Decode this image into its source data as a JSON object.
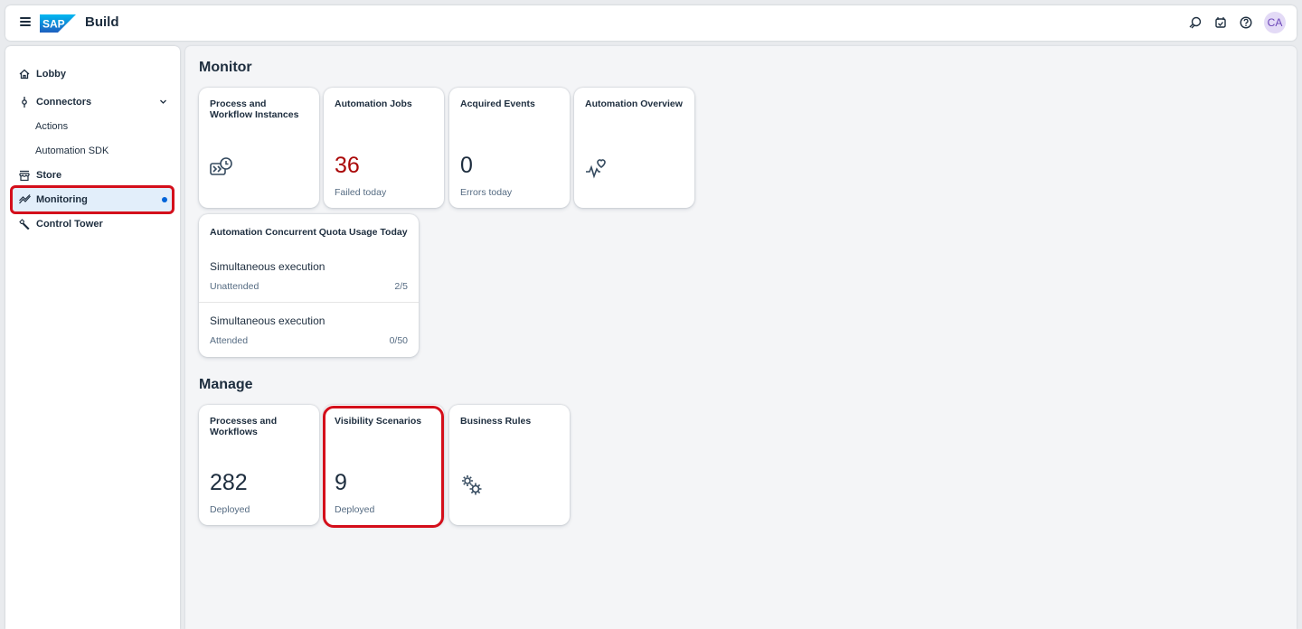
{
  "shell": {
    "product_name": "Build",
    "logo_text": "SAP",
    "avatar_initials": "CA"
  },
  "sidenav": {
    "items": [
      {
        "label": "Lobby",
        "icon": "home-icon"
      },
      {
        "label": "Connectors",
        "icon": "connector-icon"
      },
      {
        "label": "Actions"
      },
      {
        "label": "Automation SDK"
      },
      {
        "label": "Store",
        "icon": "store-icon"
      },
      {
        "label": "Monitoring",
        "icon": "monitoring-icon"
      },
      {
        "label": "Control Tower",
        "icon": "wrench-icon"
      }
    ]
  },
  "monitor": {
    "title": "Monitor",
    "tiles": [
      {
        "title": "Process and Workflow Instances",
        "icon": "process-monitor-icon"
      },
      {
        "title": "Automation Jobs",
        "number": "36",
        "sub": "Failed today"
      },
      {
        "title": "Acquired Events",
        "number": "0",
        "sub": "Errors today"
      },
      {
        "title": "Automation Overview",
        "icon": "heart-pulse-icon"
      }
    ],
    "quota": {
      "title": "Automation Concurrent Quota Usage Today",
      "rows": [
        {
          "label": "Simultaneous execution",
          "type": "Unattended",
          "value": "2/5"
        },
        {
          "label": "Simultaneous execution",
          "type": "Attended",
          "value": "0/50"
        }
      ]
    }
  },
  "manage": {
    "title": "Manage",
    "tiles": [
      {
        "title": "Processes and Workflows",
        "number": "282",
        "sub": "Deployed"
      },
      {
        "title": "Visibility Scenarios",
        "number": "9",
        "sub": "Deployed"
      },
      {
        "title": "Business Rules",
        "icon": "gears-icon"
      }
    ]
  },
  "colors": {
    "accent": "#0064d9",
    "negative": "#aa0808",
    "highlight": "#d40f1b"
  }
}
